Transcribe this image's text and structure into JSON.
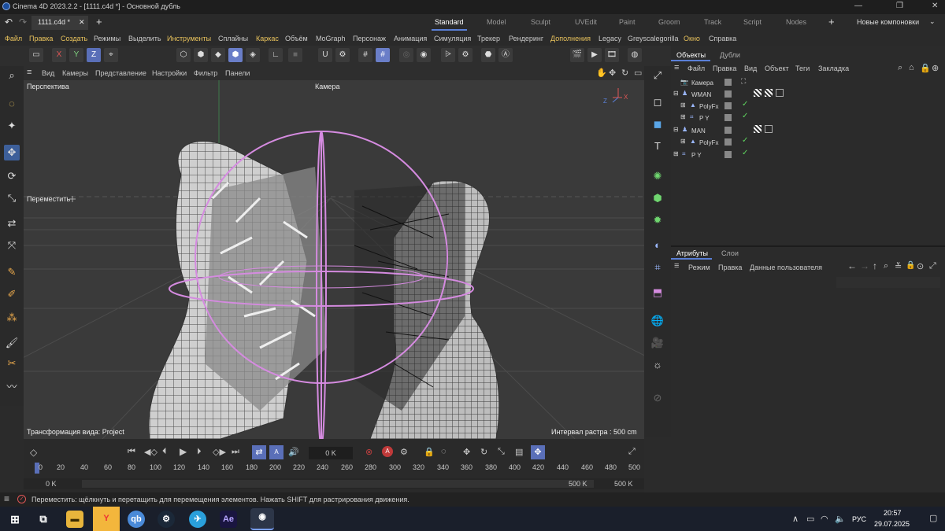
{
  "titlebar": {
    "title": "Cinema 4D 2023.2.2 - [1111.c4d *] - Основной дубль"
  },
  "tabs": {
    "doc_tab": "1111.c4d *",
    "layouts": [
      "Standard",
      "Model",
      "Sculpt",
      "UVEdit",
      "Paint",
      "Groom",
      "Track",
      "Script",
      "Nodes"
    ],
    "active_layout": "Standard",
    "new_layouts": "Новые компоновки"
  },
  "menu": [
    "Файл",
    "Правка",
    "Создать",
    "Режимы",
    "Выделить",
    "Инструменты",
    "Сплайны",
    "Каркас",
    "Объём",
    "MoGraph",
    "Персонаж",
    "Анимация",
    "Симуляция",
    "Трекер",
    "Рендеринг",
    "Дополнения",
    "Legacy",
    "Greyscalegorilla",
    "Окно",
    "Справка"
  ],
  "viewport": {
    "menu": [
      "Вид",
      "Камеры",
      "Представление",
      "Настройки",
      "Фильтр",
      "Панели"
    ],
    "label": "Перспектива",
    "camera": "Камера",
    "tool_label": "Переместить",
    "transform_info": "Трансформация вида: Project",
    "grid_info": "Интервал растра : 500 cm",
    "axis_z": "Z",
    "axis_x": "X"
  },
  "object_manager": {
    "tabs": [
      "Объекты",
      "Дубли"
    ],
    "menu": [
      "Файл",
      "Правка",
      "Вид",
      "Объект",
      "Теги",
      "Закладка"
    ],
    "rows": [
      {
        "name": "Камера",
        "indent": 0
      },
      {
        "name": "WMAN",
        "indent": 0
      },
      {
        "name": "PolyFx",
        "indent": 1
      },
      {
        "name": "P Y",
        "indent": 1
      },
      {
        "name": "MAN",
        "indent": 0
      },
      {
        "name": "PolyFx",
        "indent": 1
      },
      {
        "name": "P Y",
        "indent": 0
      }
    ]
  },
  "attributes": {
    "tabs": [
      "Атрибуты",
      "Слои"
    ],
    "menu": [
      "Режим",
      "Правка",
      "Данные пользователя"
    ]
  },
  "timeline": {
    "current_frame": "0 K",
    "ticks": [
      "0",
      "20",
      "40",
      "60",
      "80",
      "100",
      "120",
      "140",
      "160",
      "180",
      "200",
      "220",
      "240",
      "260",
      "280",
      "300",
      "320",
      "340",
      "360",
      "380",
      "400",
      "420",
      "440",
      "460",
      "480",
      "500"
    ],
    "start": "0 K",
    "start2": "0 K",
    "end": "500 K",
    "end2": "500 K"
  },
  "status": {
    "text": "Переместить: щёлкнуть и перетащить для перемещения элементов. Нажать SHIFT для растрирования движения."
  },
  "taskbar": {
    "lang": "РУС",
    "time": "20:57",
    "date": "29.07.2025"
  },
  "colors": {
    "accent": "#5a7fd6",
    "highlight_menu": "#e8c25c",
    "gizmo": "#d58be0"
  }
}
